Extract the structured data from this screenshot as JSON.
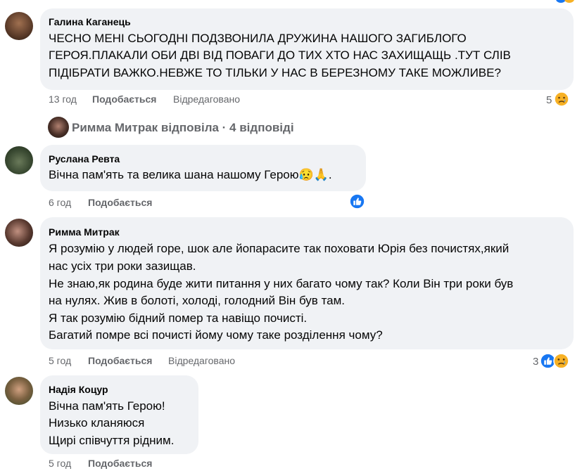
{
  "comments": [
    {
      "author": "Галина Каганець",
      "lines": [
        "ЧЕСНО МЕНІ СЬОГОДНІ ПОДЗВОНИЛА ДРУЖИНА НАШОГО ЗАГИБЛОГО",
        "ГЕРОЯ.ПЛАКАЛИ ОБИ ДВІ ВІД ПОВАГИ ДО ТИХ ХТО НАС ЗАХИЩАЩЬ .ТУТ СЛІВ",
        "ПІДІБРАТИ ВАЖКО.НЕВЖЕ ТО ТІЛЬКИ У НАС В БЕРЕЗНОМУ ТАКЕ МОЖЛИВЕ?"
      ],
      "time": "13 год",
      "like": "Подобається",
      "edited": "Відредаговано",
      "reaction_count": "5",
      "reactions": [
        "sad"
      ]
    },
    {
      "author": "Руслана Ревта",
      "lines": [
        "Вічна пам'ять та велика шана нашому Герою😥🙏."
      ],
      "time": "6 год",
      "like": "Подобається",
      "reactions": [
        "like"
      ]
    },
    {
      "author": "Римма Митрак",
      "lines": [
        "Я розумію у людей горе, шок але йопарасите так поховати Юрія без почистях,який",
        "нас усіх три роки зазищав.",
        "Не знаю,як родина буде жити питання у них багато чому так? Коли Він три роки був",
        "на нулях. Жив в болоті, холоді, голодний Він був там.",
        "Я так розумію бідний помер та навіщо почисті.",
        "Багатий помре всі почисті йому чому таке розділення чому?"
      ],
      "time": "5 год",
      "like": "Подобається",
      "edited": "Відредаговано",
      "reaction_count": "3",
      "reactions": [
        "like",
        "sad"
      ]
    },
    {
      "author": "Надія Коцур",
      "lines": [
        "Вічна пам'ять Герою!",
        "Низько кланяюся",
        "Щирі співчуття рідним."
      ],
      "time": "5 год",
      "like": "Подобається"
    }
  ],
  "replies_summary": "Римма Митрак відповіла · 4 відповіді",
  "colors": {
    "bubble": "#f0f2f5",
    "meta": "#65676b",
    "like_blue": "#1877f2",
    "sad_yellow": "#f7b125"
  }
}
